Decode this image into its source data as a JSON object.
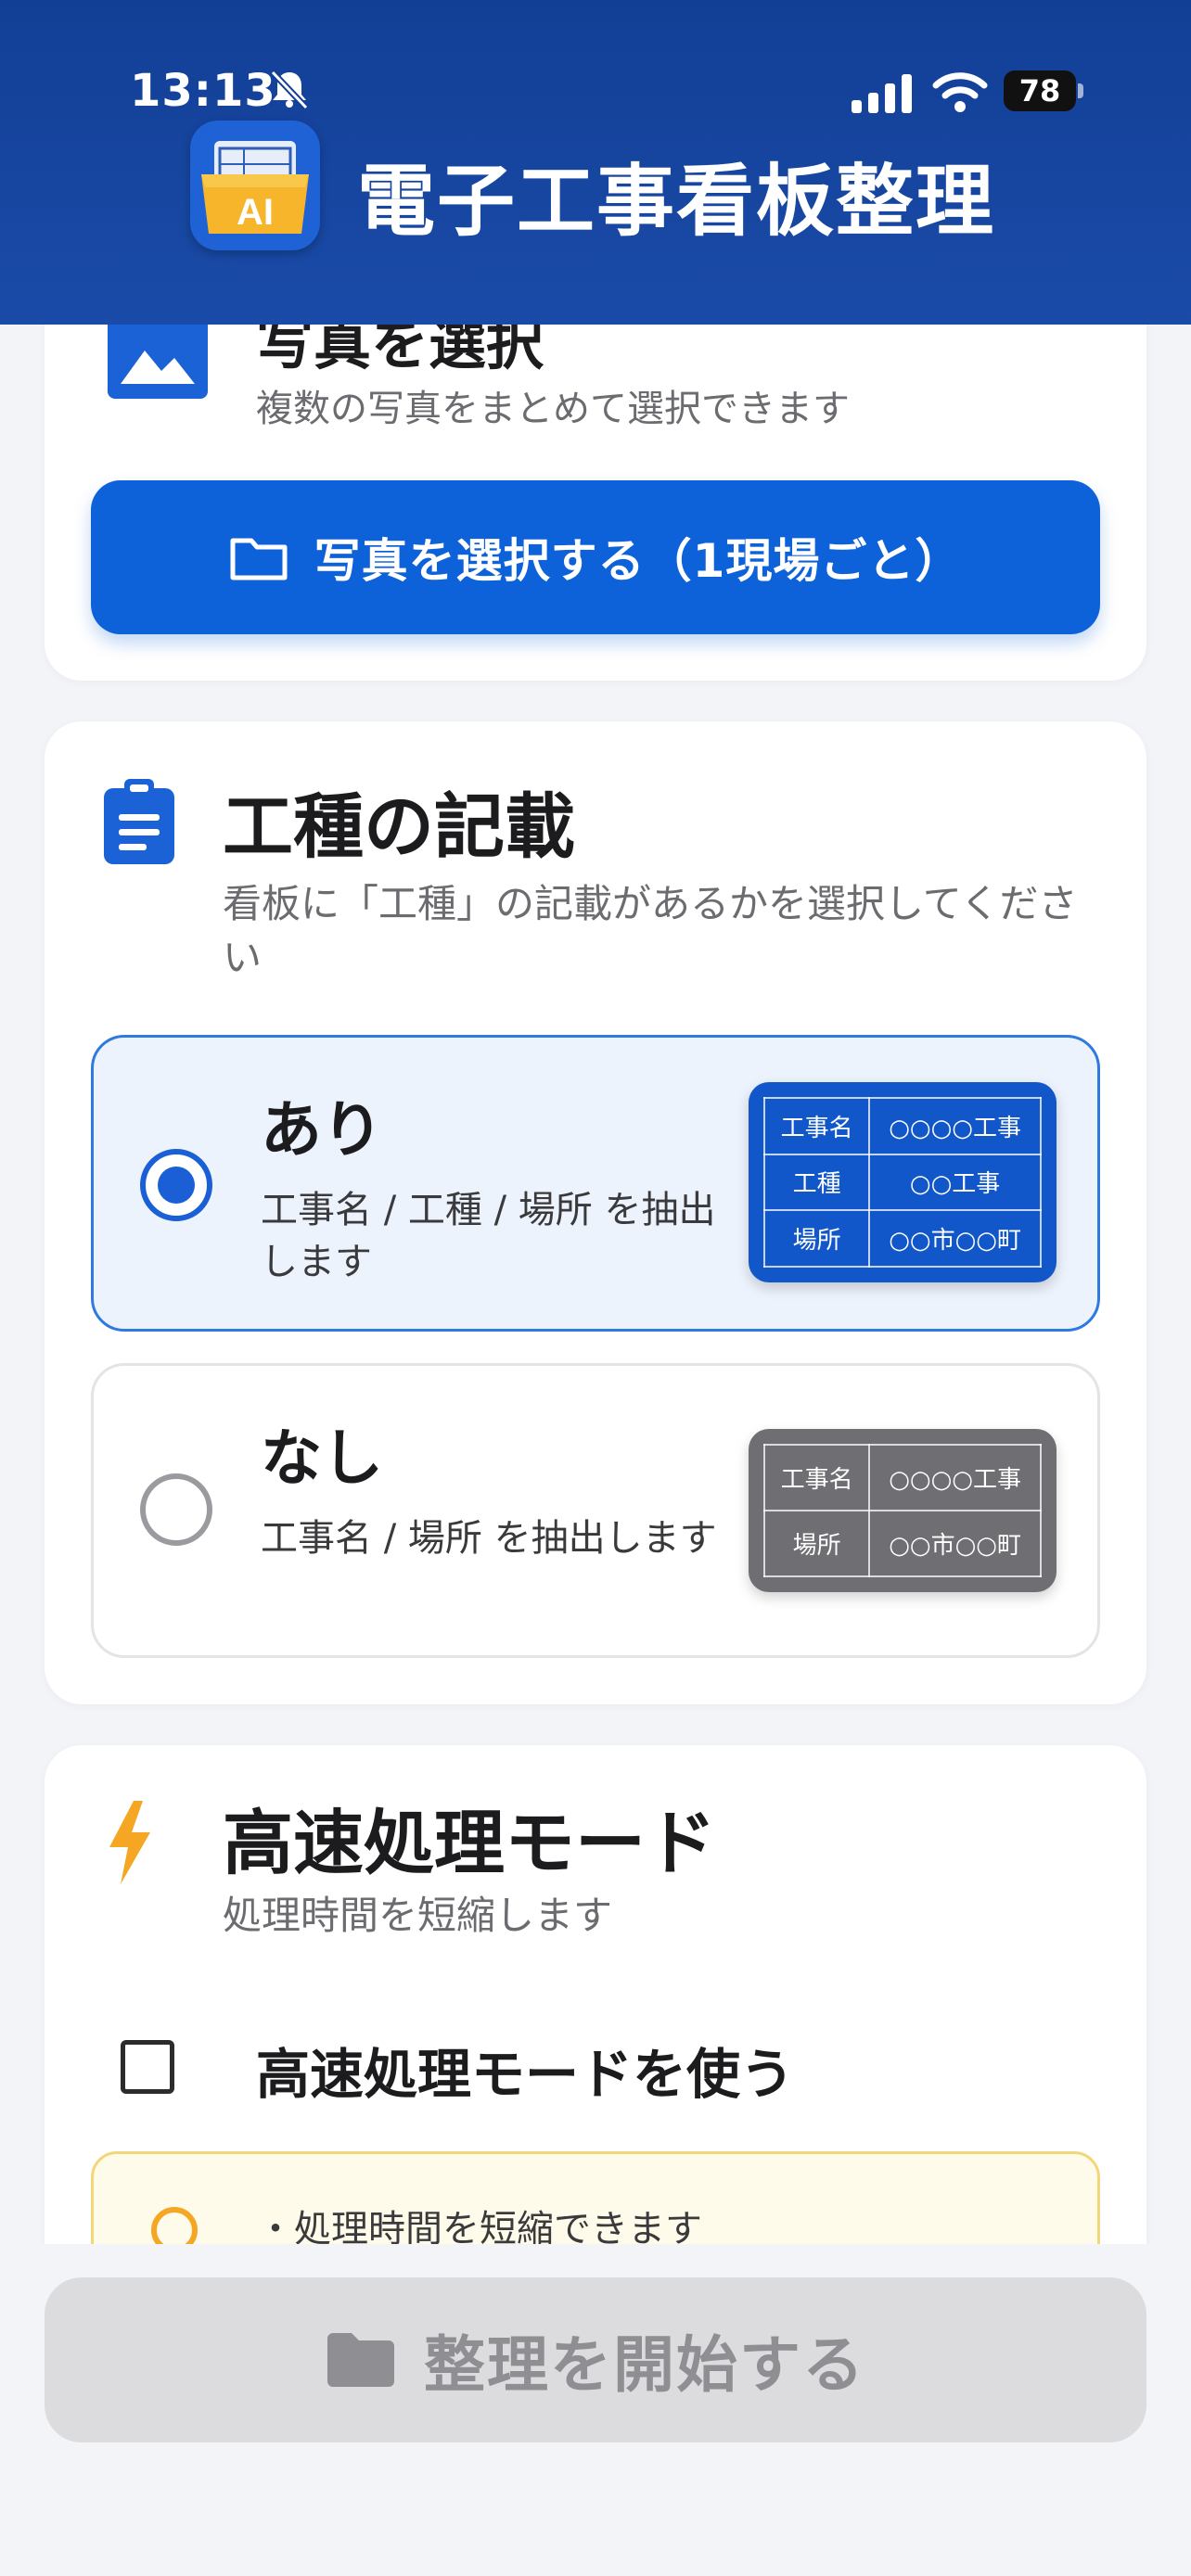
{
  "status_bar": {
    "time": "13:13",
    "battery": "78"
  },
  "header": {
    "title": "電子工事看板整理",
    "logo_text": "AI"
  },
  "photo_section": {
    "title_partial": "写真を選択",
    "description": "複数の写真をまとめて選択できます",
    "button_label": "写真を選択する（1現場ごと）"
  },
  "type_section": {
    "title": "工種の記載",
    "description": "看板に「工種」の記載があるかを選択してください",
    "options": [
      {
        "title": "あり",
        "description": "工事名 / 工種 / 場所 を抽出します",
        "selected": true,
        "sign": [
          {
            "key": "工事名",
            "value": "○○○○工事"
          },
          {
            "key": "工種",
            "value": "○○工事"
          },
          {
            "key": "場所",
            "value": "○○市○○町"
          }
        ]
      },
      {
        "title": "なし",
        "description": "工事名 / 場所 を抽出します",
        "selected": false,
        "sign": [
          {
            "key": "工事名",
            "value": "○○○○工事"
          },
          {
            "key": "場所",
            "value": "○○市○○町"
          }
        ]
      }
    ]
  },
  "fast_section": {
    "title": "高速処理モード",
    "description": "処理時間を短縮します",
    "checkbox_label": "高速処理モードを使う",
    "checked": false,
    "tip": "・処理時間を短縮できます"
  },
  "bottom": {
    "start_button_label": "整理を開始する"
  },
  "colors": {
    "header": "#123f96",
    "primary": "#0e62d9",
    "selected_bg": "#edf3fd",
    "disabled_button": "#dcdcde",
    "bolt": "#f5a623"
  }
}
